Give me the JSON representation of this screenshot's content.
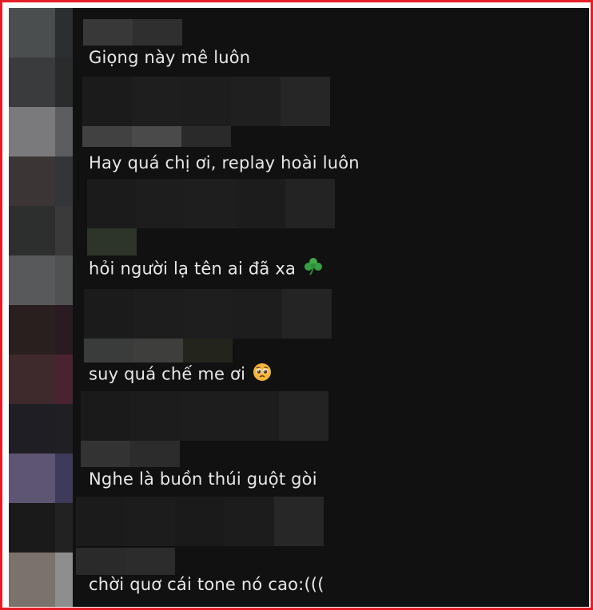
{
  "comments": [
    {
      "text": "Giọng này mê luôn"
    },
    {
      "text": "Hay quá chị ơi, replay hoài luôn"
    },
    {
      "text": "hỏi người lạ tên ai đã xa",
      "emoji": "shamrock-icon"
    },
    {
      "text": "suy quá chế me ơi",
      "emoji": "pleading-face-icon"
    },
    {
      "text": "Nghe là buồn thúi guột gòi"
    },
    {
      "text": "chời quơ cái tone nó cao:((("
    }
  ],
  "colors": {
    "frame_border": "#e41e26",
    "background": "#111111",
    "text": "#e8e8e8"
  }
}
